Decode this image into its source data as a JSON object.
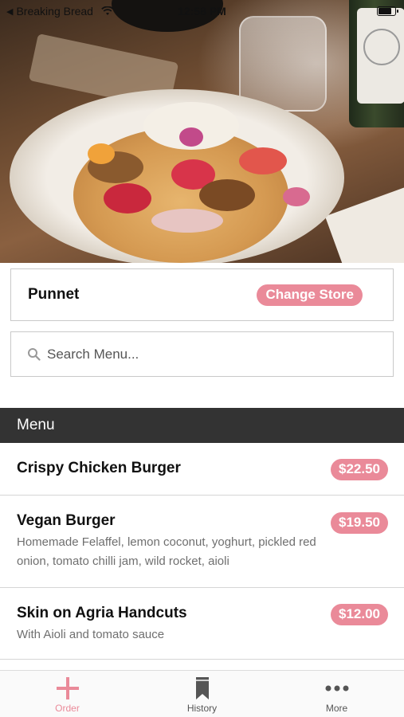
{
  "status_bar": {
    "back_label": "Breaking Bread",
    "time": "12:58 PM",
    "battery_level": 0.85
  },
  "store": {
    "name": "Punnet",
    "change_label": "Change Store"
  },
  "search": {
    "placeholder": "Search Menu..."
  },
  "menu": {
    "title": "Menu",
    "items": [
      {
        "name": "Crispy Chicken Burger",
        "price": "$22.50",
        "description": ""
      },
      {
        "name": "Vegan Burger",
        "price": "$19.50",
        "description": "Homemade Felaffel, lemon coconut, yoghurt, pickled red onion, tomato chilli jam, wild rocket, aioli"
      },
      {
        "name": "Skin on Agria Handcuts",
        "price": "$12.00",
        "description": "With Aioli and tomato sauce"
      }
    ]
  },
  "tabs": [
    {
      "label": "Order",
      "icon": "plus-icon",
      "active": true
    },
    {
      "label": "History",
      "icon": "bookmark-icon",
      "active": false
    },
    {
      "label": "More",
      "icon": "more-dots-icon",
      "active": false
    }
  ],
  "colors": {
    "accent": "#ea8a99",
    "menu_header_bg": "#333333"
  }
}
